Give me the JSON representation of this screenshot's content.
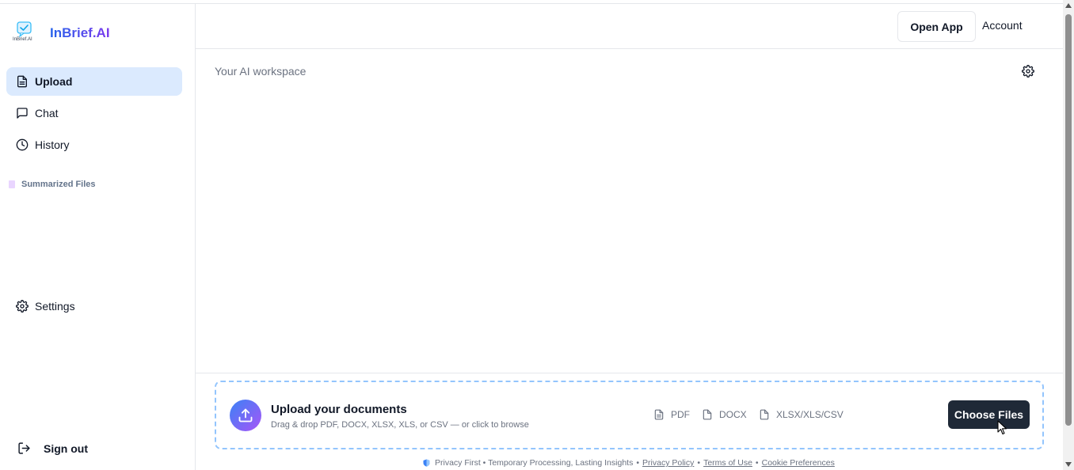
{
  "brand": {
    "name": "InBrief.AI",
    "logo_text": "InBrief.AI",
    "logo_icon": "checkbox-chat-icon"
  },
  "sidebar": {
    "items": [
      {
        "label": "Upload",
        "icon": "file-text-icon",
        "active": true
      },
      {
        "label": "Chat",
        "icon": "message-square-icon",
        "active": false
      },
      {
        "label": "History",
        "icon": "clock-icon",
        "active": false
      }
    ],
    "summarized_files_label": "Summarized Files",
    "settings_label": "Settings",
    "sign_out_label": "Sign out"
  },
  "header": {
    "open_app_label": "Open App",
    "account_label": "Account"
  },
  "main": {
    "workspace_label": "Your AI workspace"
  },
  "upload": {
    "title": "Upload your documents",
    "subtitle": "Drag & drop PDF, DOCX, XLSX, XLS, or CSV — or click to browse",
    "file_types": [
      "PDF",
      "DOCX",
      "XLSX/XLS/CSV"
    ],
    "choose_label": "Choose Files"
  },
  "footer": {
    "tagline": "Privacy First • Temporary Processing, Lasting Insights",
    "privacy_label": "Privacy Policy",
    "terms_label": "Terms of Use",
    "cookie_label": "Cookie Preferences"
  },
  "colors": {
    "accent": "#dbeafe",
    "brand_from": "#2563eb",
    "brand_to": "#7c3aed",
    "button_dark": "#1f2937",
    "dropzone_border": "#93c5fd"
  }
}
